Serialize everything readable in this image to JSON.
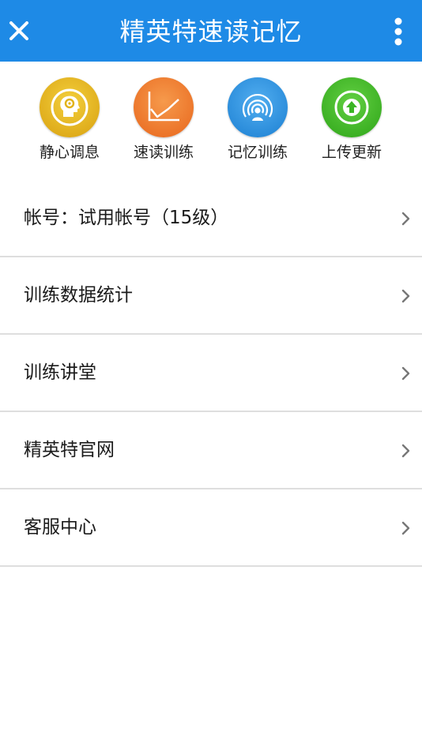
{
  "header": {
    "title": "精英特速读记忆",
    "close_icon": "close-icon",
    "more_icon": "more-vertical-icon",
    "color": "#1e8ae6"
  },
  "shortcuts": [
    {
      "label": "静心调息",
      "icon": "head-meditation-icon",
      "color": "#e2b31b"
    },
    {
      "label": "速读训练",
      "icon": "line-chart-icon",
      "color": "#ee7a2c"
    },
    {
      "label": "记忆训练",
      "icon": "memory-signal-icon",
      "color": "#2f93e0"
    },
    {
      "label": "上传更新",
      "icon": "upload-arrow-icon",
      "color": "#3bb624"
    }
  ],
  "menu": [
    {
      "label": "帐号：试用帐号（15级）"
    },
    {
      "label": "训练数据统计"
    },
    {
      "label": "训练讲堂"
    },
    {
      "label": "精英特官网"
    },
    {
      "label": "客服中心"
    }
  ],
  "chevron_icon": "chevron-right-icon"
}
